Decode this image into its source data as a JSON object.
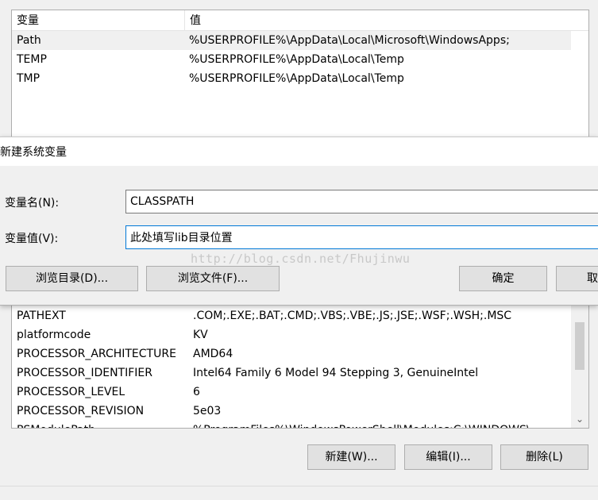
{
  "user_vars": {
    "headers": {
      "variable": "变量",
      "value": "值"
    },
    "rows": [
      {
        "name": "Path",
        "value": "%USERPROFILE%\\AppData\\Local\\Microsoft\\WindowsApps;"
      },
      {
        "name": "TEMP",
        "value": "%USERPROFILE%\\AppData\\Local\\Temp"
      },
      {
        "name": "TMP",
        "value": "%USERPROFILE%\\AppData\\Local\\Temp"
      }
    ]
  },
  "dialog": {
    "title": "新建系统变量",
    "name_label": "变量名(N):",
    "name_value": "CLASSPATH",
    "value_label": "变量值(V):",
    "value_value": "此处填写lib目录位置",
    "browse_dir": "浏览目录(D)...",
    "browse_file": "浏览文件(F)...",
    "ok": "确定",
    "cancel": "取消"
  },
  "watermark": "http://blog.csdn.net/Fhujinwu",
  "system_vars": {
    "rows": [
      {
        "name": "PATHEXT",
        "value": ".COM;.EXE;.BAT;.CMD;.VBS;.VBE;.JS;.JSE;.WSF;.WSH;.MSC"
      },
      {
        "name": "platformcode",
        "value": "KV"
      },
      {
        "name": "PROCESSOR_ARCHITECTURE",
        "value": "AMD64"
      },
      {
        "name": "PROCESSOR_IDENTIFIER",
        "value": "Intel64 Family 6 Model 94 Stepping 3, GenuineIntel"
      },
      {
        "name": "PROCESSOR_LEVEL",
        "value": "6"
      },
      {
        "name": "PROCESSOR_REVISION",
        "value": "5e03"
      },
      {
        "name": "PSModulePath",
        "value": "%ProgramFiles%\\WindowsPowerShell\\Modules;C:\\WINDOWS\\"
      }
    ],
    "buttons": {
      "new": "新建(W)...",
      "edit": "编辑(I)...",
      "delete": "删除(L)"
    }
  },
  "icons": {
    "scroll_down": "chevron-down-icon"
  },
  "colors": {
    "focus_border": "#0078d7",
    "button_bg": "#e1e1e1"
  }
}
